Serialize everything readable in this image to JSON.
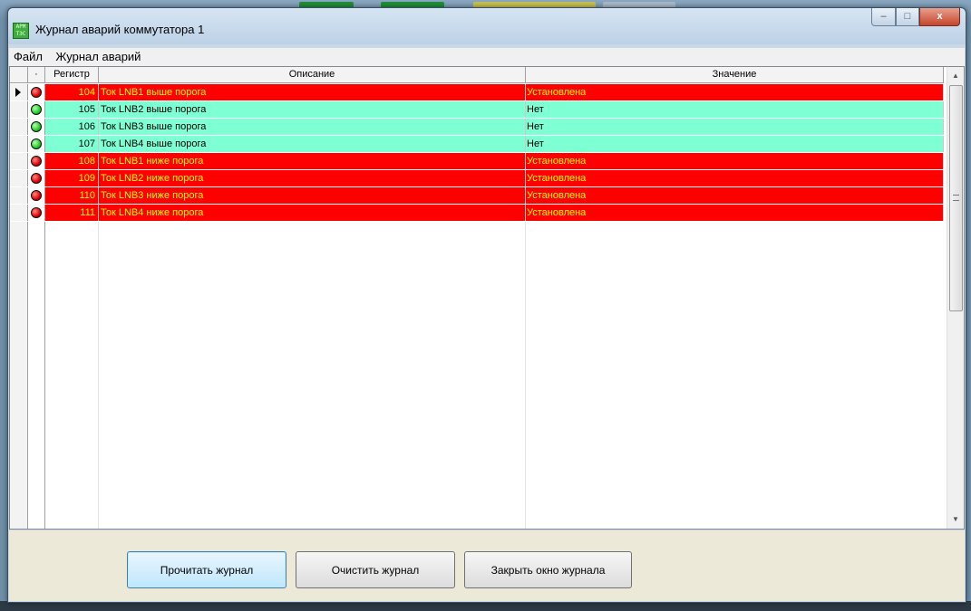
{
  "window": {
    "title": "Журнал аварий коммутатора 1",
    "icon_text": "АРМ ТЭС",
    "controls": {
      "minimize": "–",
      "maximize": "□",
      "close": "x"
    }
  },
  "menu": {
    "items": [
      "Файл",
      "Журнал аварий"
    ]
  },
  "grid": {
    "columns": {
      "marker": "·",
      "register": "Регистр",
      "description": "Описание",
      "value": "Значение"
    },
    "rows": [
      {
        "status": "alarm",
        "lamp": "red",
        "register": "104",
        "description": "Ток LNB1 выше порога",
        "value": "Установлена",
        "selected": true
      },
      {
        "status": "ok",
        "lamp": "green",
        "register": "105",
        "description": "Ток LNB2 выше порога",
        "value": "Нет"
      },
      {
        "status": "ok",
        "lamp": "green",
        "register": "106",
        "description": "Ток LNB3 выше порога",
        "value": "Нет"
      },
      {
        "status": "ok",
        "lamp": "green",
        "register": "107",
        "description": "Ток LNB4 выше порога",
        "value": "Нет"
      },
      {
        "status": "alarm",
        "lamp": "red",
        "register": "108",
        "description": "Ток LNB1 ниже порога",
        "value": "Установлена"
      },
      {
        "status": "alarm",
        "lamp": "red",
        "register": "109",
        "description": "Ток LNB2 ниже порога",
        "value": "Установлена"
      },
      {
        "status": "alarm",
        "lamp": "red",
        "register": "110",
        "description": "Ток LNB3 ниже порога",
        "value": "Установлена"
      },
      {
        "status": "alarm",
        "lamp": "red",
        "register": "111",
        "description": "Ток LNB4 ниже порога",
        "value": "Установлена"
      }
    ],
    "colors": {
      "alarm_bg": "#ff0000",
      "alarm_text": "#ffff00",
      "ok_bg": "#7fffd4",
      "ok_text": "#000000"
    },
    "scroll": {
      "up": "▲",
      "down": "▼"
    }
  },
  "buttons": {
    "read": "Прочитать журнал",
    "clear": "Очистить журнал",
    "close": "Закрыть окно журнала"
  }
}
